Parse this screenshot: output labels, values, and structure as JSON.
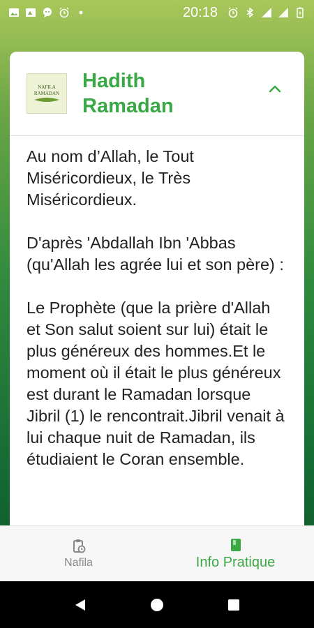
{
  "status_bar": {
    "time": "20:18",
    "left_icons": [
      "image-icon",
      "photo-icon",
      "chat-icon",
      "alarm-icon",
      "dot-icon"
    ],
    "right_icons": [
      "alarm-icon",
      "bluetooth-icon",
      "signal-icon",
      "signal-icon",
      "battery-icon"
    ]
  },
  "card": {
    "logo_text_line1": "NAFILA",
    "logo_text_line2": "RAMADAN",
    "title": "Hadith Ramadan",
    "expanded": true,
    "paragraphs": [
      "Au nom d’Allah, le Tout Miséricordieux, le Très Miséricordieux.",
      "D'après 'Abdallah Ibn 'Abbas (qu'Allah les agrée lui et son père) :",
      "Le Prophète (que la prière d'Allah et Son salut soient sur lui) était le plus généreux des hommes.Et le moment où il était le plus généreux est durant le Ramadan lorsque Jibril (1) le rencontrait.Jibril venait à lui chaque nuit de Ramadan, ils étudiaient le Coran ensemble."
    ]
  },
  "bottom_nav": {
    "items": [
      {
        "label": "Nafila",
        "icon": "clipboard-clock-icon",
        "active": false
      },
      {
        "label": "Info Pratique",
        "icon": "book-icon",
        "active": true
      }
    ]
  },
  "colors": {
    "accent": "#3aa844",
    "inactive": "#888888"
  }
}
